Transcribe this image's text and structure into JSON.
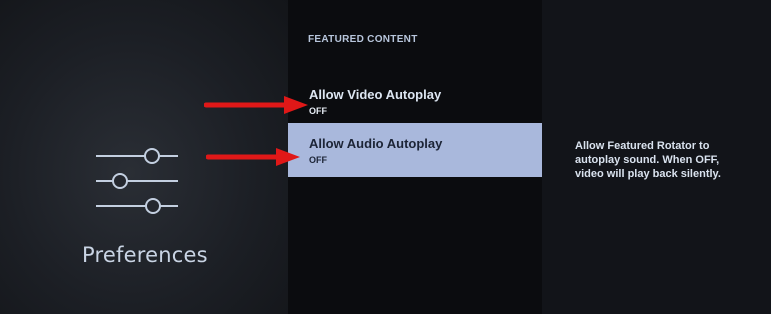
{
  "sidebar": {
    "title": "Preferences",
    "icon": "sliders-icon"
  },
  "featured": {
    "header": "FEATURED CONTENT",
    "items": [
      {
        "label": "Allow Video Autoplay",
        "value": "OFF"
      },
      {
        "label": "Allow Audio Autoplay",
        "value": "OFF",
        "selected": true
      }
    ]
  },
  "description": "Allow Featured Rotator to autoplay sound. When OFF, video will play back silently.",
  "colors": {
    "highlight": "#a9b8dc",
    "arrow": "#e01818",
    "background": "#0e1014"
  }
}
